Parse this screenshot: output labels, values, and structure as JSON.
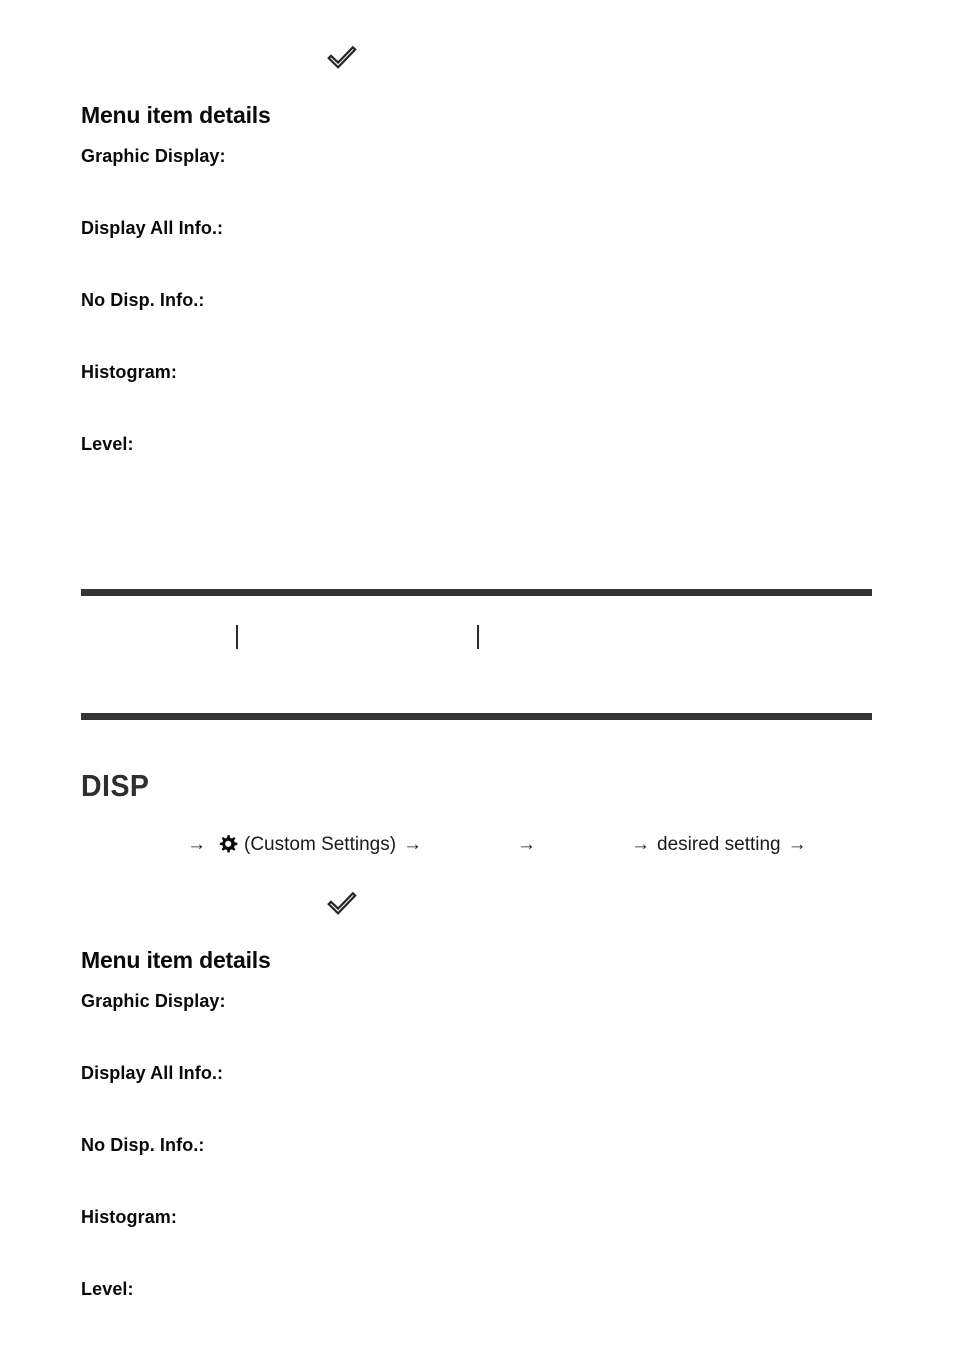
{
  "page": {
    "background_color": "#ffffff",
    "text_color": "#0a0a0a",
    "rule_color": "#333333",
    "accent_color": "#2e2e2e"
  },
  "sections": [
    {
      "id": "upper",
      "check_icon": "check-mark-icon",
      "heading": "Menu item details",
      "items": [
        {
          "label": "Graphic Display:"
        },
        {
          "label": "Display All Info.:"
        },
        {
          "label": "No Disp. Info.:"
        },
        {
          "label": "Histogram:"
        },
        {
          "label": "Level:"
        }
      ]
    },
    {
      "id": "lower",
      "check_icon": "check-mark-icon",
      "heading": "Menu item details",
      "items": [
        {
          "label": "Graphic Display:"
        },
        {
          "label": "Display All Info.:"
        },
        {
          "label": "No Disp. Info.:"
        },
        {
          "label": "Histogram:"
        },
        {
          "label": "Level:"
        }
      ]
    }
  ],
  "divider": {
    "top_rule": "",
    "bottom_rule": "",
    "nav_separator_1": "|",
    "nav_separator_2": "|"
  },
  "disp_block": {
    "wordmark": "DISP",
    "menu_path": {
      "arrow_1": "→",
      "gear_icon": "gear-icon",
      "custom_settings_label": "(Custom Settings)",
      "arrow_2": "→",
      "arrow_3": "→",
      "arrow_4": "→",
      "desired_setting_label": "desired setting",
      "arrow_5": "→"
    }
  }
}
